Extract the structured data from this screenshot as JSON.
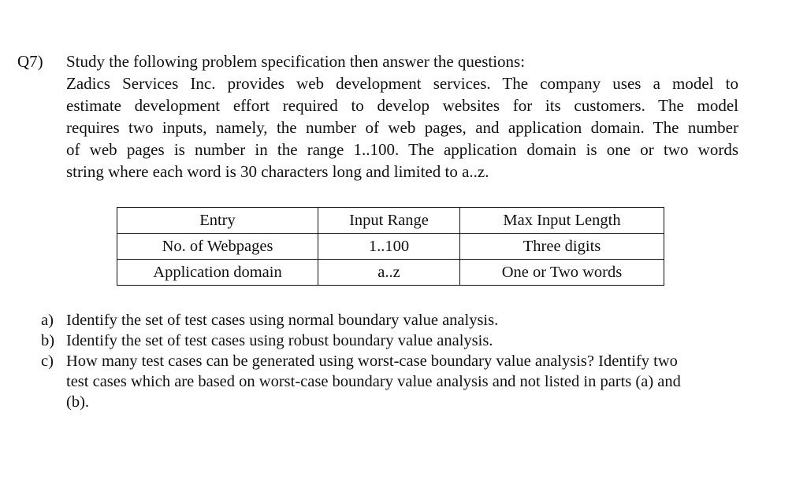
{
  "question": {
    "number": "Q7)",
    "intro": "Study the following problem specification then answer the questions:",
    "paragraph_lines": [
      "Zadics Services Inc. provides web development services. The company uses a model to",
      "estimate development effort required to develop websites for its customers. The model",
      "requires two inputs, namely, the number of web pages, and application domain. The number",
      "of web pages is number in the range 1..100. The application domain is one or two words",
      "string where each word is 30 characters long and limited to a..z."
    ]
  },
  "table": {
    "headers": [
      "Entry",
      "Input Range",
      "Max Input Length"
    ],
    "rows": [
      [
        "No. of Webpages",
        "1..100",
        "Three digits"
      ],
      [
        "Application domain",
        "a..z",
        "One or Two words"
      ]
    ]
  },
  "subquestions": [
    {
      "label": "a)",
      "lines": [
        "Identify the set of test cases using normal boundary value analysis."
      ]
    },
    {
      "label": "b)",
      "lines": [
        "Identify the set of test cases using robust boundary value analysis."
      ]
    },
    {
      "label": "c)",
      "lines": [
        "How many test cases can be generated using worst-case boundary value analysis? Identify two",
        "test cases which are based on worst-case boundary value analysis and not listed in parts (a) and",
        "(b)."
      ]
    }
  ]
}
